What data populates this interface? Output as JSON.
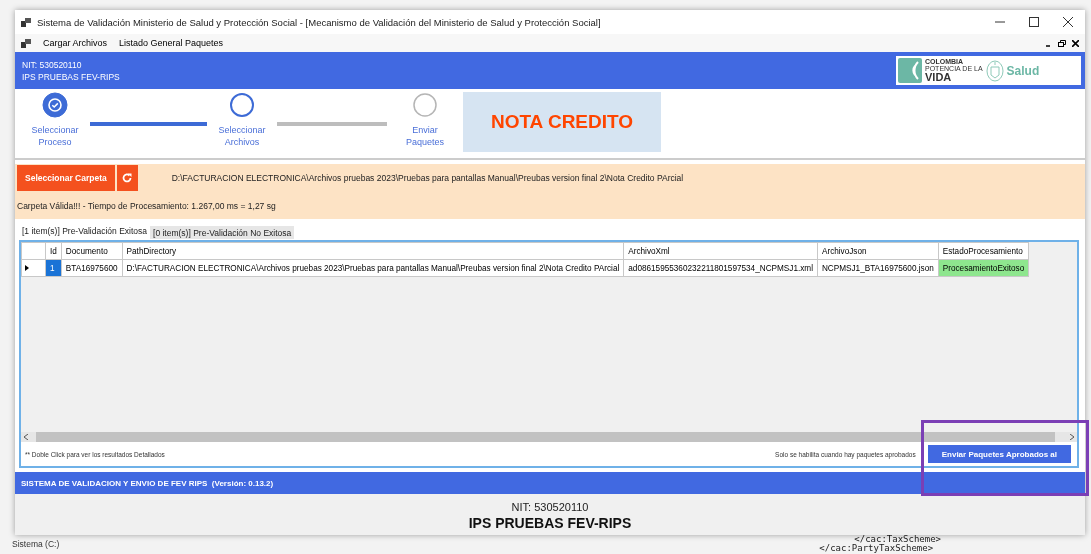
{
  "window": {
    "title": "Sistema de Validación Ministerio de Salud y Protección Social - [Mecanismo de Validación del Ministerio de Salud y Protección Social]"
  },
  "menu": {
    "items": [
      "Cargar Archivos",
      "Listado General Paquetes"
    ]
  },
  "header": {
    "nit": "NIT: 530520110",
    "entity": "IPS PRUEBAS FEV-RIPS",
    "logo": {
      "line1": "COLOMBIA",
      "line2": "POTENCIA DE LA",
      "line3": "VIDA",
      "brand": "Salud"
    }
  },
  "steps": [
    {
      "label": "Seleccionar Proceso",
      "completed": true,
      "active": false
    },
    {
      "label": "Seleccionar Archivos",
      "completed": false,
      "active": true
    },
    {
      "label": "Enviar Paquetes",
      "completed": false,
      "active": false
    }
  ],
  "process_title": "NOTA CREDITO",
  "folder": {
    "button": "Seleccionar Carpeta",
    "path": "D:\\FACTURACION ELECTRONICA\\Archivos pruebas 2023\\Pruebas para pantallas Manual\\Preubas version final 2\\Nota Credito PArcial",
    "status": "Carpeta Válida!!! - Tiempo de Procesamiento: 1.267,00 ms = 1,27 sg"
  },
  "tabs": [
    {
      "label": "[1 item(s)] Pre-Validación Exitosa",
      "selected": true
    },
    {
      "label": "[0 item(s)] Pre-Validación No Exitosa",
      "selected": false
    }
  ],
  "table": {
    "columns": [
      "Id",
      "Documento",
      "PathDirectory",
      "ArchivoXml",
      "ArchivoJson",
      "EstadoProcesamiento"
    ],
    "rows": [
      {
        "selected": true,
        "success": true,
        "cells": [
          "1",
          "BTA16975600",
          "D:\\FACTURACION ELECTRONICA\\Archivos pruebas 2023\\Pruebas para pantallas Manual\\Preubas version final 2\\Nota Credito PArcial",
          "ad08615955360232211801597534_NCPMSJ1.xml",
          "NCPMSJ1_BTA16975600.json",
          "ProcesamientoExitoso"
        ]
      }
    ]
  },
  "hint": "** Doble Click para ver los resultados Detallados",
  "send": {
    "note": "Solo se habilita cuando hay paquetes aprobados",
    "button": "Enviar Paquetes Aprobados al"
  },
  "footer_bar": "SISTEMA DE VALIDACION Y ENVIO DE FEV RIPS  (Versión: 0.13.2)",
  "footer": {
    "nit": "NIT: 530520110",
    "entity": "IPS PRUEBAS FEV-RIPS"
  },
  "background": {
    "drive_label": "Sistema (C:)",
    "code_lines": [
      "</cac:TaxScheme>",
      "</cac:PartyTaxScheme>"
    ]
  }
}
